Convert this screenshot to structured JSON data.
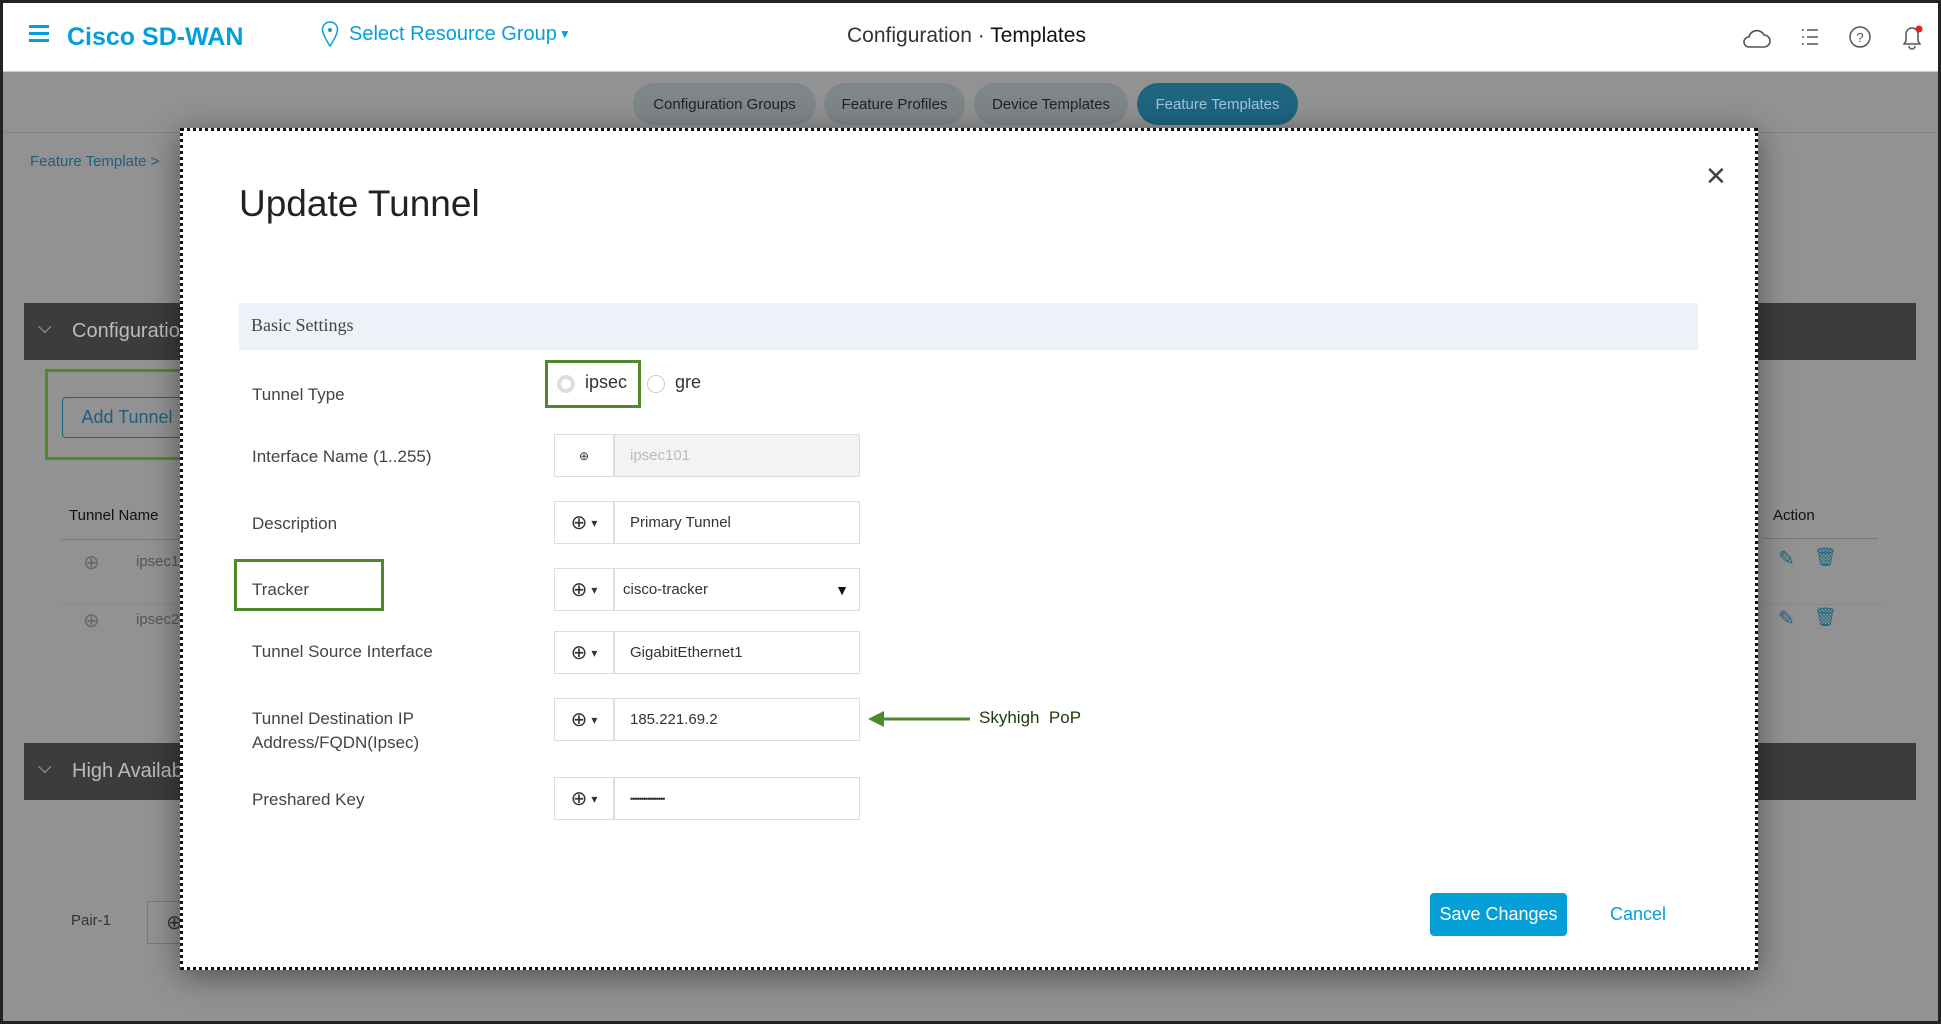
{
  "header": {
    "brand": "Cisco SD-WAN",
    "resource_group": "Select Resource Group",
    "title_section": "Configuration",
    "title_separator": "·",
    "title_page": "Templates"
  },
  "tabs": [
    {
      "label": "Configuration Groups"
    },
    {
      "label": "Feature Profiles"
    },
    {
      "label": "Device Templates"
    },
    {
      "label": "Feature Templates",
      "active": true
    }
  ],
  "background": {
    "breadcrumb": "Feature Template",
    "config_section": "Configuration",
    "add_tunnel": "Add Tunnel",
    "table_header_name": "Tunnel Name",
    "table_header_action": "Action",
    "rows": [
      {
        "name": "ipsec1"
      },
      {
        "name": "ipsec2"
      }
    ],
    "ha_section": "High Availability",
    "pair_label": "Pair-1"
  },
  "modal": {
    "title": "Update Tunnel",
    "section": "Basic Settings",
    "fields": {
      "tunnel_type": {
        "label": "Tunnel Type",
        "options": [
          "ipsec",
          "gre"
        ],
        "selected": "ipsec"
      },
      "interface_name": {
        "label": "Interface Name (1..255)",
        "value": "ipsec101"
      },
      "description": {
        "label": "Description",
        "value": "Primary Tunnel"
      },
      "tracker": {
        "label": "Tracker",
        "value": "cisco-tracker"
      },
      "source_interface": {
        "label": "Tunnel Source Interface",
        "value": "GigabitEthernet1"
      },
      "destination": {
        "label_line1": "Tunnel Destination IP",
        "label_line2": "Address/FQDN(Ipsec)",
        "value": "185.221.69.2"
      },
      "preshared_key": {
        "label": "Preshared Key",
        "value": "••••••••••••••••"
      }
    },
    "annotation": "Skyhigh  PoP",
    "save": "Save Changes",
    "cancel": "Cancel"
  },
  "colors": {
    "brand": "#049fd9",
    "annotation_green": "#4e8a2b",
    "active_tab": "#1e6580",
    "save_button": "#049fd9"
  }
}
